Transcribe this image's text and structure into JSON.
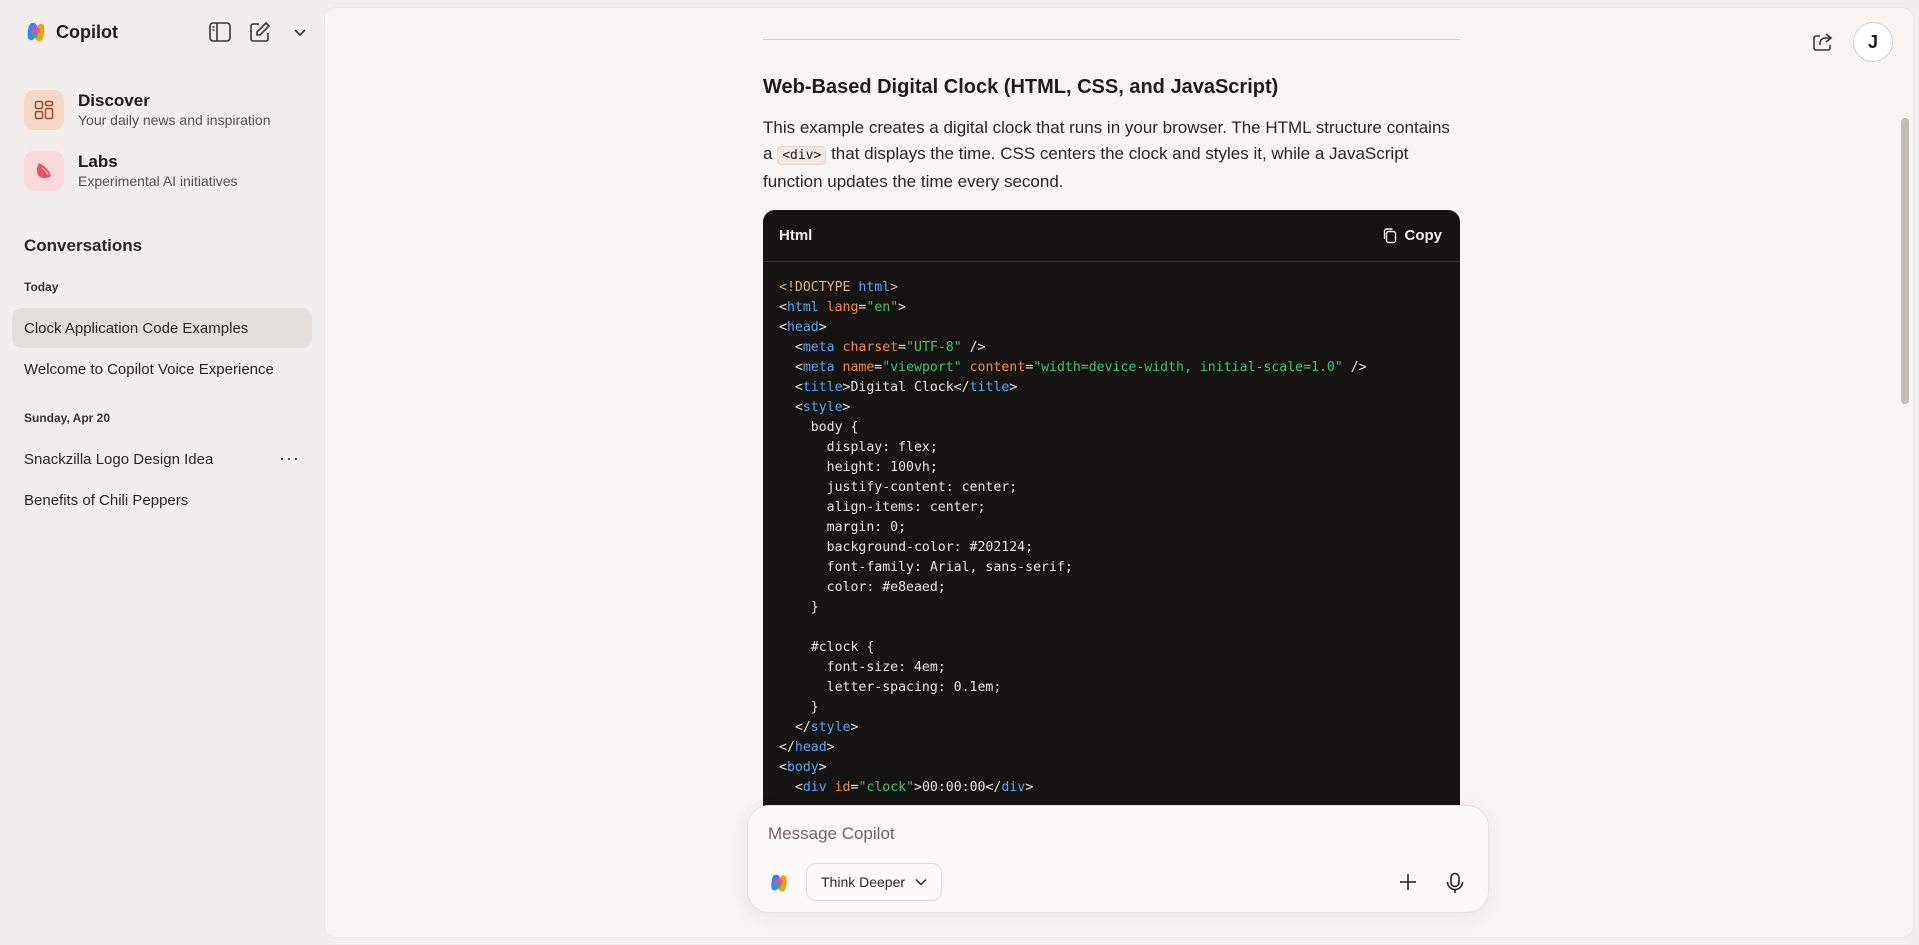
{
  "app": {
    "name": "Copilot"
  },
  "sidebar": {
    "nav": [
      {
        "title": "Discover",
        "subtitle": "Your daily news and inspiration"
      },
      {
        "title": "Labs",
        "subtitle": "Experimental AI initiatives"
      }
    ],
    "section_title": "Conversations",
    "groups": [
      {
        "label": "Today",
        "items": [
          "Clock Application Code Examples",
          "Welcome to Copilot Voice Experience"
        ]
      },
      {
        "label": "Sunday, Apr 20",
        "items": [
          "Snackzilla Logo Design Idea",
          "Benefits of Chili Peppers"
        ]
      }
    ]
  },
  "header": {
    "avatar_initial": "J"
  },
  "article": {
    "heading": "Web-Based Digital Clock (HTML, CSS, and JavaScript)",
    "p_before": "This example creates a digital clock that runs in your browser. The HTML structure contains a",
    "inline_code": "<div>",
    "p_after": "that displays the time. CSS centers the clock and styles it, while a JavaScript function updates the time every second."
  },
  "code": {
    "language": "Html",
    "copy_label": "Copy",
    "lines": [
      [
        [
          "doc",
          "<!DOCTYPE "
        ],
        [
          "tag",
          "html"
        ],
        [
          "doc",
          ">"
        ]
      ],
      [
        [
          "",
          "<"
        ],
        [
          "tag",
          "html"
        ],
        [
          "attr",
          " lang"
        ],
        [
          "",
          "="
        ],
        [
          "str",
          "\"en\""
        ],
        [
          "",
          ">"
        ]
      ],
      [
        [
          "",
          "<"
        ],
        [
          "tag",
          "head"
        ],
        [
          "",
          ">"
        ]
      ],
      [
        [
          "",
          "  <"
        ],
        [
          "tag",
          "meta"
        ],
        [
          "attr",
          " charset"
        ],
        [
          "",
          "="
        ],
        [
          "str",
          "\"UTF-8\""
        ],
        [
          "",
          " />"
        ]
      ],
      [
        [
          "",
          "  <"
        ],
        [
          "tag",
          "meta"
        ],
        [
          "attr",
          " name"
        ],
        [
          "",
          "="
        ],
        [
          "str",
          "\"viewport\""
        ],
        [
          "attr",
          " content"
        ],
        [
          "",
          "="
        ],
        [
          "str",
          "\"width=device-width, initial-scale=1.0\""
        ],
        [
          "",
          " />"
        ]
      ],
      [
        [
          "",
          "  <"
        ],
        [
          "tag",
          "title"
        ],
        [
          "",
          ">Digital Clock</"
        ],
        [
          "tag",
          "title"
        ],
        [
          "",
          ">"
        ]
      ],
      [
        [
          "",
          "  <"
        ],
        [
          "tag",
          "style"
        ],
        [
          "",
          ">"
        ]
      ],
      [
        [
          "",
          "    body {"
        ]
      ],
      [
        [
          "",
          "      display: flex;"
        ]
      ],
      [
        [
          "",
          "      height: 100vh;"
        ]
      ],
      [
        [
          "",
          "      justify-content: center;"
        ]
      ],
      [
        [
          "",
          "      align-items: center;"
        ]
      ],
      [
        [
          "",
          "      margin: 0;"
        ]
      ],
      [
        [
          "",
          "      background-color: #202124;"
        ]
      ],
      [
        [
          "",
          "      font-family: Arial, sans-serif;"
        ]
      ],
      [
        [
          "",
          "      color: #e8eaed;"
        ]
      ],
      [
        [
          "",
          "    }"
        ]
      ],
      [
        [
          "",
          ""
        ]
      ],
      [
        [
          "",
          "    #clock {"
        ]
      ],
      [
        [
          "",
          "      font-size: 4em;"
        ]
      ],
      [
        [
          "",
          "      letter-spacing: 0.1em;"
        ]
      ],
      [
        [
          "",
          "    }"
        ]
      ],
      [
        [
          "",
          "  </"
        ],
        [
          "tag",
          "style"
        ],
        [
          "",
          ">"
        ]
      ],
      [
        [
          "",
          "</"
        ],
        [
          "tag",
          "head"
        ],
        [
          "",
          ">"
        ]
      ],
      [
        [
          "",
          "<"
        ],
        [
          "tag",
          "body"
        ],
        [
          "",
          ">"
        ]
      ],
      [
        [
          "",
          "  <"
        ],
        [
          "tag",
          "div"
        ],
        [
          "attr",
          " id"
        ],
        [
          "",
          "="
        ],
        [
          "str",
          "\"clock\""
        ],
        [
          "",
          ">00:00:00</"
        ],
        [
          "tag",
          "div"
        ],
        [
          "",
          ">"
        ]
      ]
    ]
  },
  "composer": {
    "placeholder": "Message Copilot",
    "mode_label": "Think Deeper"
  }
}
